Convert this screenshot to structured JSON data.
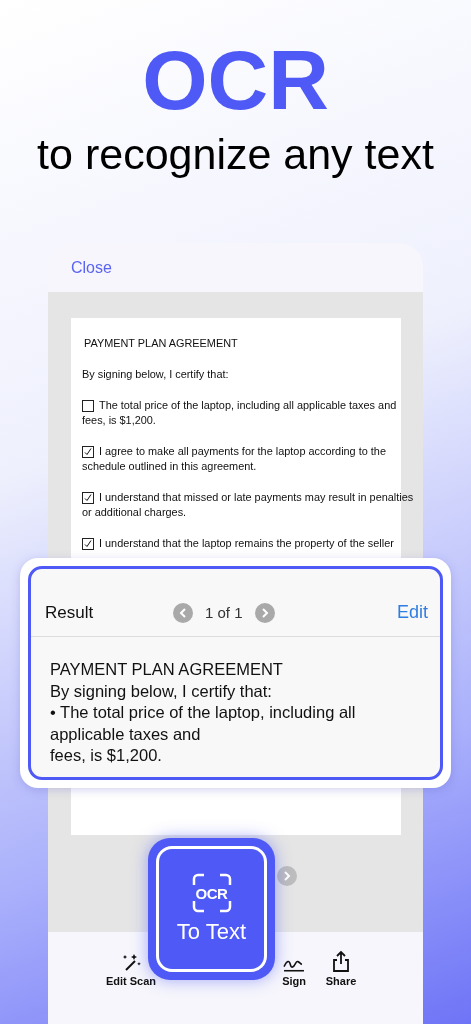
{
  "hero": {
    "title": "OCR",
    "subtitle": "to recognize any text"
  },
  "header": {
    "close": "Close"
  },
  "document": {
    "title": "PAYMENT PLAN AGREEMENT",
    "intro": "By signing below, I certify that:",
    "items": [
      {
        "lines": [
          "The total price of the laptop, including all applicable taxes and",
          "fees, is $1,200."
        ],
        "checked": false
      },
      {
        "lines": [
          "I agree to make all payments for the laptop according to the",
          "schedule outlined in this agreement."
        ],
        "checked": true
      },
      {
        "lines": [
          "I understand that missed or late payments may result in penalties",
          "or additional charges."
        ],
        "checked": true
      },
      {
        "lines": [
          "I understand that the laptop remains the property of the seller"
        ],
        "checked": true
      }
    ]
  },
  "result": {
    "title": "Result",
    "pager": "1 of 1",
    "edit": "Edit",
    "lines": [
      "PAYMENT PLAN AGREEMENT",
      "By signing below, I certify that:",
      "• The total price of the laptop, including all applicable taxes and",
      "fees, is $1,200."
    ]
  },
  "toolbar": [
    {
      "kind": "wand",
      "label": "Edit Scan"
    },
    {
      "kind": "sign",
      "label": "Sign"
    },
    {
      "kind": "share",
      "label": "Share"
    }
  ],
  "ocr_button": {
    "badge": "OCR",
    "label": "To Text"
  }
}
